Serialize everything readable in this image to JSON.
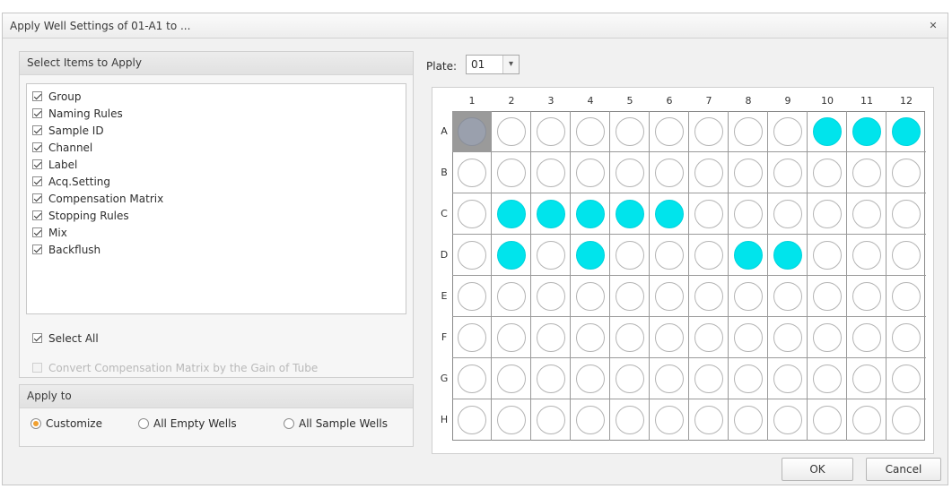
{
  "title": "Apply Well Settings of  01-A1 to ...",
  "close_glyph": "✕",
  "select_items": {
    "header": "Select Items to Apply",
    "items": [
      {
        "label": "Group",
        "checked": true
      },
      {
        "label": "Naming Rules",
        "checked": true
      },
      {
        "label": "Sample ID",
        "checked": true
      },
      {
        "label": "Channel",
        "checked": true
      },
      {
        "label": "Label",
        "checked": true
      },
      {
        "label": "Acq.Setting",
        "checked": true
      },
      {
        "label": "Compensation Matrix",
        "checked": true
      },
      {
        "label": "Stopping Rules",
        "checked": true
      },
      {
        "label": "Mix",
        "checked": true
      },
      {
        "label": "Backflush",
        "checked": true
      }
    ],
    "select_all": "Select All",
    "select_all_checked": true,
    "convert_label": "Convert Compensation Matrix by the Gain of Tube",
    "convert_checked": false
  },
  "apply_to": {
    "header": "Apply to",
    "options": [
      "Customize",
      "All Empty Wells",
      "All Sample Wells"
    ],
    "selected": "Customize"
  },
  "plate": {
    "label": "Plate:",
    "value": "01",
    "arrow": "▾",
    "columns": [
      "1",
      "2",
      "3",
      "4",
      "5",
      "6",
      "7",
      "8",
      "9",
      "10",
      "11",
      "12"
    ],
    "rows": [
      "A",
      "B",
      "C",
      "D",
      "E",
      "F",
      "G",
      "H"
    ],
    "selected_well": "A1",
    "filled_wells": [
      "A10",
      "A11",
      "A12",
      "C2",
      "C3",
      "C4",
      "C5",
      "C6",
      "D2",
      "D4",
      "D8",
      "D9"
    ],
    "filled_color": "#00e4ec"
  },
  "buttons": {
    "ok": "OK",
    "cancel": "Cancel"
  }
}
